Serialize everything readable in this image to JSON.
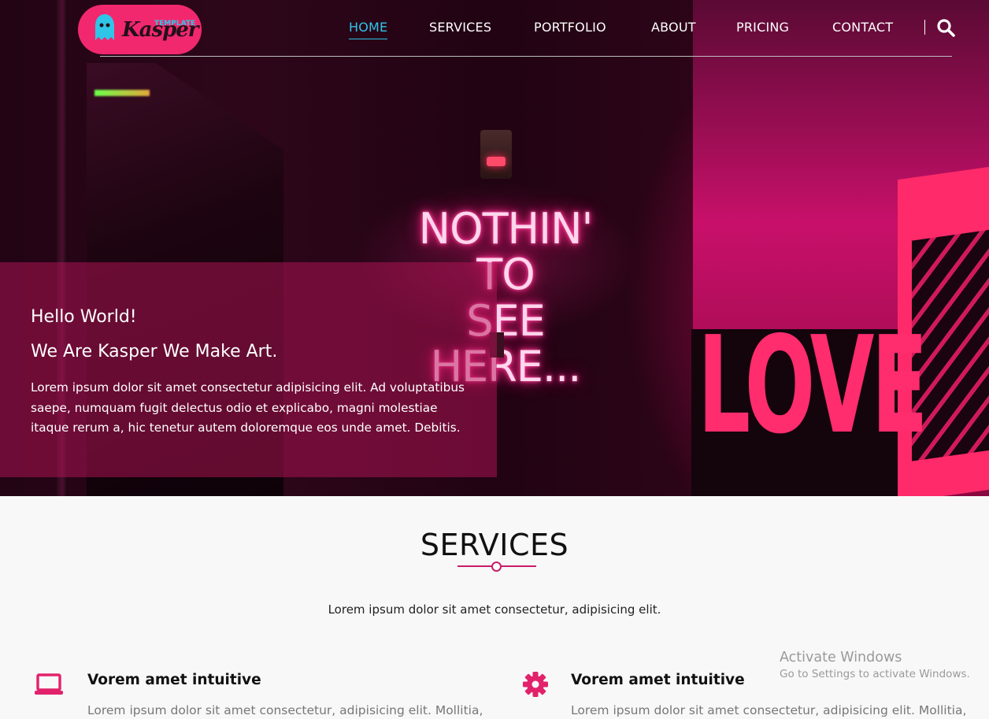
{
  "brand": {
    "logo_top": "TEMPLATE",
    "logo_main": "Kasper",
    "accent": "#f2286e",
    "nav_active_color": "#2fc5e8"
  },
  "nav": {
    "items": [
      {
        "label": "HOME",
        "active": true
      },
      {
        "label": "SERVICES",
        "active": false
      },
      {
        "label": "PORTFOLIO",
        "active": false
      },
      {
        "label": "ABOUT",
        "active": false
      },
      {
        "label": "PRICING",
        "active": false
      },
      {
        "label": "CONTACT",
        "active": false
      }
    ],
    "search_icon": "search-icon"
  },
  "hero": {
    "neon_line1": "NOTHIN' TO",
    "neon_line2": "SEE HERE...",
    "sign_text": "LOVE",
    "greeting": "Hello World!",
    "tagline": "We Are Kasper We Make Art.",
    "text_line1": "Lorem ipsum dolor sit amet consectetur adipisicing elit. Ad voluptatibus",
    "text_line2": "saepe, numquam fugit delectus odio et explicabo, magni molestiae",
    "text_line3": "itaque rerum a, hic tenetur autem doloremque eos unde amet. Debitis."
  },
  "services": {
    "title": "SERVICES",
    "subtitle": "Lorem ipsum dolor sit amet consectetur, adipisicing elit.",
    "items": [
      {
        "icon": "laptop-icon",
        "title": "Vorem amet intuitive",
        "text": "Lorem ipsum dolor sit amet consectetur, adipisicing elit. Mollitia,"
      },
      {
        "icon": "gear-icon",
        "title": "Vorem amet intuitive",
        "text": "Lorem ipsum dolor sit amet consectetur, adipisicing elit. Mollitia,"
      }
    ]
  },
  "watermark": {
    "line1": "Activate Windows",
    "line2": "Go to Settings to activate Windows."
  }
}
